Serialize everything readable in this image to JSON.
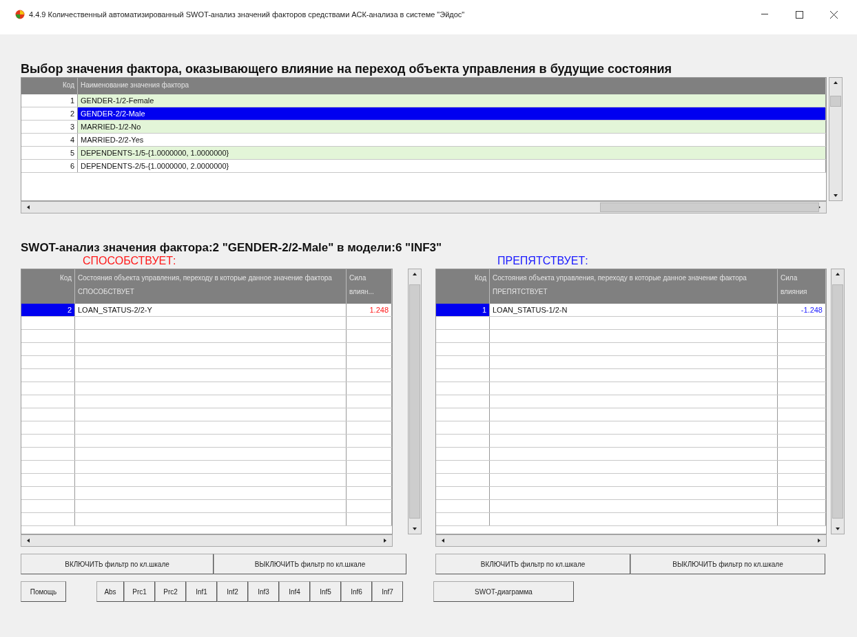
{
  "window": {
    "title": "4.4.9 Количественный автоматизированный SWOT-анализ значений факторов средствами АСК-анализа в системе \"Эйдос\""
  },
  "factor_table": {
    "heading": "Выбор значения фактора, оказывающего влияние на переход объекта управления в будущие состояния",
    "columns": [
      "Код",
      "Наименование значения фактора"
    ],
    "rows": [
      {
        "code": "1",
        "name": "GENDER-1/2-Female",
        "selected": false
      },
      {
        "code": "2",
        "name": "GENDER-2/2-Male",
        "selected": true
      },
      {
        "code": "3",
        "name": "MARRIED-1/2-No",
        "selected": false
      },
      {
        "code": "4",
        "name": "MARRIED-2/2-Yes",
        "selected": false
      },
      {
        "code": "5",
        "name": "DEPENDENTS-1/5-{1.0000000, 1.0000000}",
        "selected": false
      },
      {
        "code": "6",
        "name": "DEPENDENTS-2/5-{1.0000000, 2.0000000}",
        "selected": false
      }
    ]
  },
  "swot": {
    "heading": "SWOT-анализ значения фактора:2 \"GENDER-2/2-Male\" в модели:6 \"INF3\"",
    "panels": [
      {
        "kind": "promotes",
        "label": "СПОСОБСТВУЕТ:",
        "columns": [
          "Код",
          "Состояния объекта управления, переходу в которые данное значение фактора СПОСОБСТВУЕТ",
          "Сила влиян..."
        ],
        "rows": [
          {
            "code": "2",
            "name": "LOAN_STATUS-2/2-Y",
            "value": "1.248",
            "selected": true
          }
        ],
        "buttons": [
          "ВКЛЮЧИТЬ фильтр по кл.шкале",
          "ВЫКЛЮЧИТЬ фильтр по кл.шкале"
        ]
      },
      {
        "kind": "hinders",
        "label": "ПРЕПЯТСТВУЕТ:",
        "columns": [
          "Код",
          "Состояния объекта управления, переходу в которые данное значение фактора ПРЕПЯТСТВУЕТ",
          "Сила влияния"
        ],
        "rows": [
          {
            "code": "1",
            "name": "LOAN_STATUS-1/2-N",
            "value": "-1.248",
            "selected": true
          }
        ],
        "buttons": [
          "ВКЛЮЧИТЬ фильтр по кл.шкале",
          "ВЫКЛЮЧИТЬ фильтр по кл.шкале"
        ]
      }
    ]
  },
  "help_button": "Помощь",
  "model_buttons": [
    "Abs",
    "Prc1",
    "Prc2",
    "Inf1",
    "Inf2",
    "Inf3",
    "Inf4",
    "Inf5",
    "Inf6",
    "Inf7"
  ],
  "diagram_button": "SWOT-диаграмма"
}
